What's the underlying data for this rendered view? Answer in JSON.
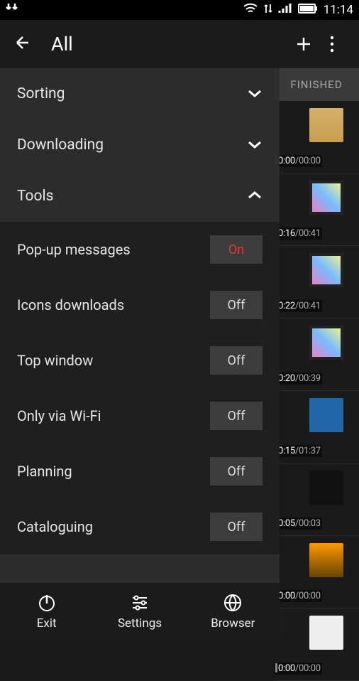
{
  "status": {
    "time": "11:14"
  },
  "actionbar": {
    "title": "All"
  },
  "background": {
    "tab": "FINISHED",
    "rows": [
      {
        "elapsed": "0:00",
        "total": "00:00",
        "bar": "#888",
        "thumb": "zip"
      },
      {
        "elapsed": "0:16",
        "total": "00:41",
        "bar": "#6c0",
        "thumb": "vid"
      },
      {
        "elapsed": "0:22",
        "total": "00:41",
        "bar": "#6c0",
        "thumb": "vid"
      },
      {
        "elapsed": "0:20",
        "total": "00:39",
        "bar": "#6c0",
        "thumb": "vid"
      },
      {
        "elapsed": "0:15",
        "total": "01:37",
        "bar": "#888",
        "thumb": "mon"
      },
      {
        "elapsed": "0:05",
        "total": "00:03",
        "bar": "#6c0",
        "thumb": "aud"
      },
      {
        "elapsed": "0:00",
        "total": "00:00",
        "bar": "#888",
        "thumb": "pic"
      },
      {
        "elapsed": "0:00",
        "total": "00:00",
        "bar": "#888",
        "thumb": "doc"
      }
    ]
  },
  "drawer": {
    "sections": [
      {
        "label": "Sorting",
        "expanded": false
      },
      {
        "label": "Downloading",
        "expanded": false
      },
      {
        "label": "Tools",
        "expanded": true
      }
    ],
    "tools": [
      {
        "label": "Pop-up messages",
        "value": "On",
        "on": true
      },
      {
        "label": "Icons downloads",
        "value": "Off",
        "on": false
      },
      {
        "label": "Top window",
        "value": "Off",
        "on": false
      },
      {
        "label": "Only via Wi-Fi",
        "value": "Off",
        "on": false
      },
      {
        "label": "Planning",
        "value": "Off",
        "on": false
      },
      {
        "label": "Cataloguing",
        "value": "Off",
        "on": false
      }
    ]
  },
  "nav": {
    "items": [
      {
        "label": "Exit"
      },
      {
        "label": "Settings"
      },
      {
        "label": "Browser"
      }
    ]
  }
}
